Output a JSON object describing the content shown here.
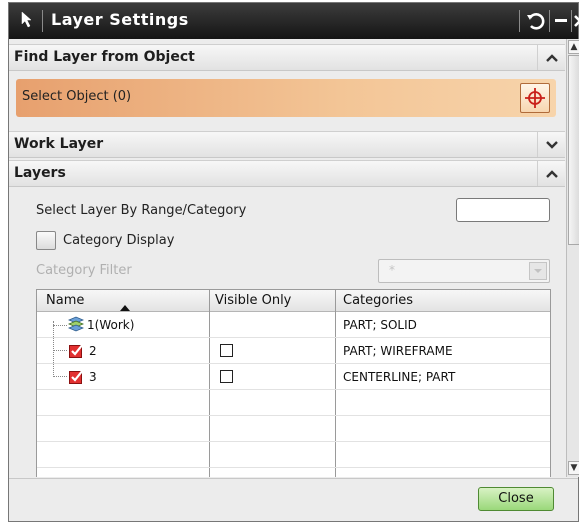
{
  "window": {
    "title": "Layer Settings"
  },
  "sections": {
    "find_layer": "Find Layer from Object",
    "work_layer": "Work Layer",
    "layers": "Layers"
  },
  "select_object": {
    "label": "Select Object (0)"
  },
  "layers_panel": {
    "range_label": "Select Layer By Range/Category",
    "range_value": "",
    "category_display_label": "Category Display",
    "category_filter_label": "Category Filter",
    "category_filter_value": "*"
  },
  "table": {
    "headers": [
      "Name",
      "Visible Only",
      "Categories"
    ],
    "rows": [
      {
        "name": "1(Work)",
        "visible_only": null,
        "categories": "PART; SOLID"
      },
      {
        "name": "2",
        "visible_only": false,
        "categories": "PART; WIREFRAME"
      },
      {
        "name": "3",
        "visible_only": false,
        "categories": "CENTERLINE; PART"
      }
    ]
  },
  "footer": {
    "close_label": "Close"
  },
  "colors": {
    "titlebar": "#222222",
    "select_bar": "#f0b887",
    "close_button": "#a6dc86",
    "check_red": "#d01818"
  },
  "icons": [
    "window-menu-icon",
    "reset-icon",
    "minimize-icon",
    "close-icon",
    "chevron-up-icon",
    "chevron-down-icon",
    "crosshair-icon",
    "layer-stack-icon",
    "checked-layer-icon",
    "sort-ascending-icon",
    "dropdown-arrow-icon"
  ]
}
